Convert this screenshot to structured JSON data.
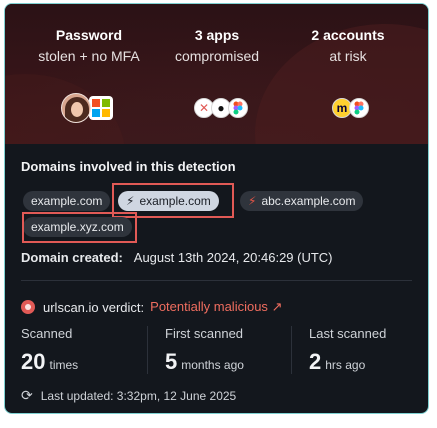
{
  "stats": [
    {
      "title": "Password",
      "subtitle": "stolen + no MFA"
    },
    {
      "title": "3 apps",
      "subtitle": "compromised"
    },
    {
      "title": "2 accounts",
      "subtitle": "at risk"
    }
  ],
  "icons": {
    "avatar": "user-avatar-icon",
    "microsoft": "microsoft-icon",
    "apps": [
      "dropbox-icon",
      "github-icon",
      "figma-icon"
    ],
    "accounts": [
      "miro-icon",
      "figma-icon"
    ]
  },
  "domains": {
    "title": "Domains involved in this detection",
    "chips": [
      "example.com",
      "example.com",
      "abc.example.com",
      "example.xyz.com"
    ],
    "created_label": "Domain created:",
    "created_value": "August 13th 2024, 20:46:29 (UTC)"
  },
  "urlscan": {
    "label": "urlscan.io verdict:",
    "verdict": "Potentially malicious",
    "verdict_icon": "↗",
    "scanned_label": "Scanned",
    "scanned_value": "20",
    "scanned_unit": "times",
    "first_label": "First scanned",
    "first_value": "5",
    "first_unit": "months ago",
    "last_label": "Last scanned",
    "last_value": "2",
    "last_unit": "hrs ago",
    "updated": "Last updated: 3:32pm, 12 June 2025"
  },
  "colors": {
    "accent_border": "#7fd1d2",
    "highlight": "#e15a56",
    "malicious": "#ef6d5f",
    "bolt_red": "#e55446"
  }
}
